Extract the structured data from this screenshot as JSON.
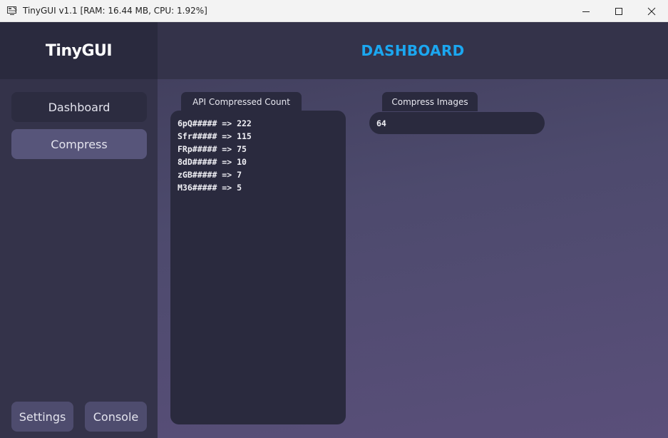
{
  "window": {
    "title": "TinyGUI v1.1 [RAM: 16.44 MB, CPU: 1.92%]"
  },
  "sidebar": {
    "logo": "TinyGUI",
    "nav": [
      {
        "label": "Dashboard"
      },
      {
        "label": "Compress"
      }
    ],
    "footer": {
      "settings_label": "Settings",
      "console_label": "Console"
    }
  },
  "header": {
    "title": "DASHBOARD"
  },
  "api_panel": {
    "label": "API Compressed Count",
    "lines": [
      "6pQ##### => 222",
      "Sfr##### => 115",
      "FRp##### => 75",
      "8dD##### => 10",
      "zGB##### => 7",
      "M36##### => 5"
    ]
  },
  "images_panel": {
    "label": "Compress Images",
    "value": "64"
  },
  "colors": {
    "accent": "#1ba7f0",
    "sidebar_bg": "#34334a",
    "panel_bg": "#2a2a3e",
    "active_nav": "#57557a"
  },
  "icons": {
    "app": "app-window-icon",
    "minimize": "minimize-icon",
    "maximize": "maximize-icon",
    "close": "close-icon"
  }
}
